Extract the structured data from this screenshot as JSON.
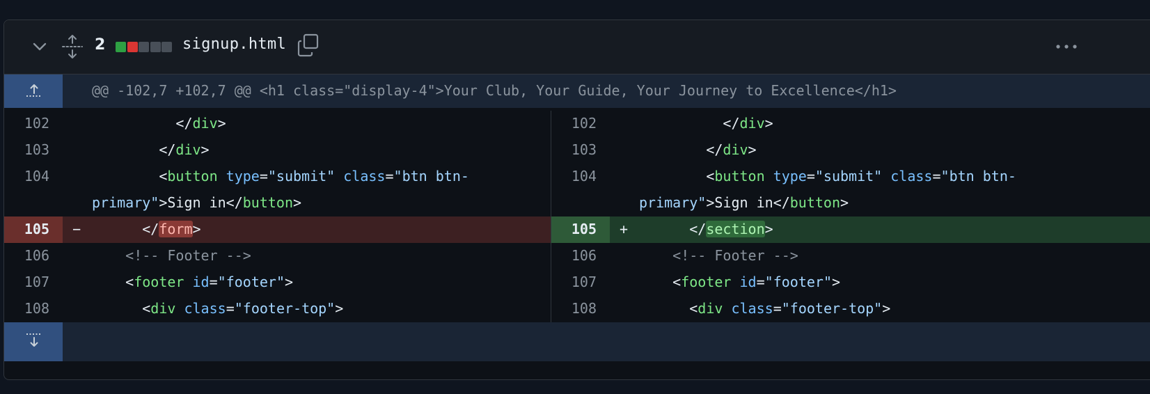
{
  "file": {
    "changes_count": "2",
    "filename": "signup.html",
    "diffstat": [
      "add",
      "del",
      "neutral",
      "neutral",
      "neutral"
    ]
  },
  "icons": {
    "collapse": "chevron-down-icon",
    "expand_all": "unfold-icon",
    "copy": "copy-icon",
    "more": "kebab-horizontal-icon",
    "expand_up": "expand-up-icon",
    "expand_down": "expand-down-icon"
  },
  "hunk": {
    "header": "@@ -102,7 +102,7 @@ <h1 class=\"display-4\">Your Club, Your Guide, Your Journey to Excellence</h1>"
  },
  "left": {
    "lines": [
      {
        "num": "102"
      },
      {
        "num": "103"
      },
      {
        "num": "104"
      },
      {
        "num": "105",
        "marker": "−"
      },
      {
        "num": "106"
      },
      {
        "num": "107"
      },
      {
        "num": "108"
      }
    ]
  },
  "right": {
    "lines": [
      {
        "num": "102"
      },
      {
        "num": "103"
      },
      {
        "num": "104"
      },
      {
        "num": "105",
        "marker": "+"
      },
      {
        "num": "106"
      },
      {
        "num": "107"
      },
      {
        "num": "108"
      }
    ]
  },
  "code": {
    "l102": [
      "          </",
      "div",
      ">"
    ],
    "l103": [
      "        </",
      "div",
      ">"
    ],
    "l104_a": [
      "        <",
      "button",
      " ",
      "type",
      "=",
      "\"submit\"",
      " ",
      "class",
      "=",
      "\"btn btn-"
    ],
    "l104_b": [
      "primary\"",
      ">Sign in</",
      "button",
      ">"
    ],
    "del105": [
      "      </",
      "form",
      ">"
    ],
    "add105": [
      "      </",
      "section",
      ">"
    ],
    "l106": "    <!-- Footer -->",
    "l107": [
      "    <",
      "footer",
      " ",
      "id",
      "=",
      "\"footer\"",
      ">"
    ],
    "l108": [
      "      <",
      "div",
      " ",
      "class",
      "=",
      "\"footer-top\"",
      ">"
    ]
  },
  "colors": {
    "tag": "#7ee787",
    "attr": "#79c0ff",
    "string": "#a5d6ff",
    "deletion_bg": "#3d2022",
    "addition_bg": "#1e3d2a",
    "hunk_gutter": "#31507f"
  }
}
